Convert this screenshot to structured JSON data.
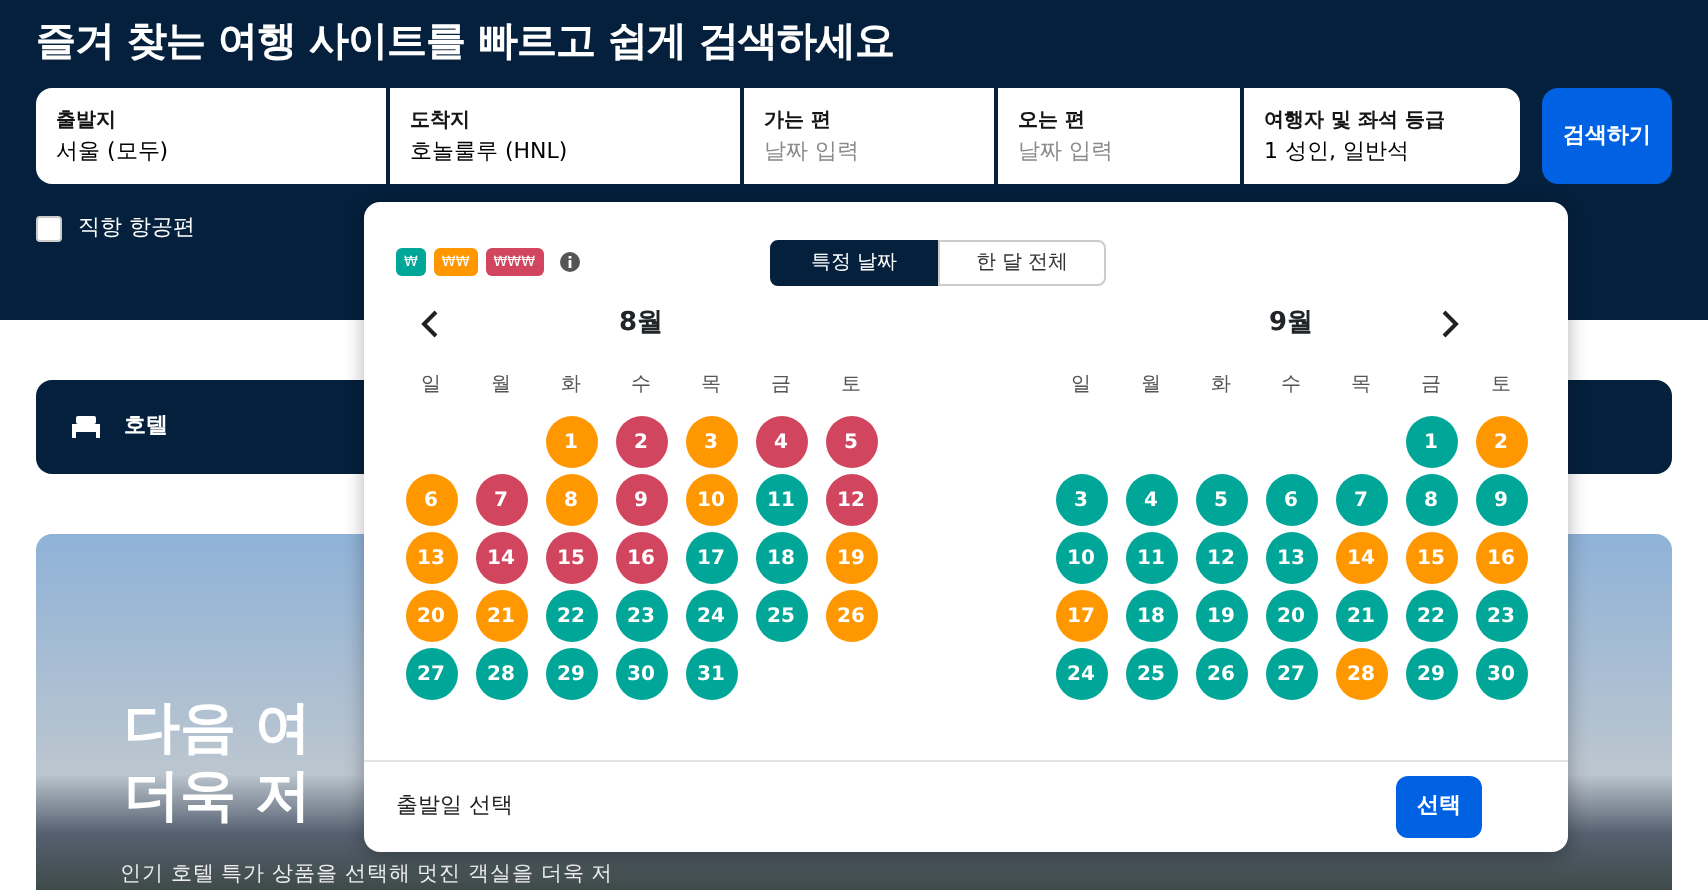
{
  "header": {
    "title": "즐겨 찾는 여행 사이트를 빠르고 쉽게 검색하세요"
  },
  "search_fields": [
    {
      "label": "출발지",
      "value": "서울 (모두)"
    },
    {
      "label": "도착지",
      "value": "호놀룰루 (HNL)"
    },
    {
      "label": "가는 편",
      "placeholder": "날짜 입력"
    },
    {
      "label": "오는 편",
      "placeholder": "날짜 입력"
    },
    {
      "label": "여행자 및 좌석 등급",
      "value": "1 성인, 일반석"
    }
  ],
  "search_button": "검색하기",
  "direct_flights": {
    "label": "직항 항공편",
    "checked": false
  },
  "hotel_tab": {
    "label": "호텔"
  },
  "hero": {
    "title_lines": [
      "다음 여",
      "더욱 저"
    ],
    "subtitle": "인기 호텔 특가 상품을 선택해 멋진 객실을 더욱 저"
  },
  "date_picker": {
    "legend": [
      {
        "label": "₩",
        "color": "#00a698"
      },
      {
        "label": "₩₩",
        "color": "#ff9800"
      },
      {
        "label": "₩₩₩",
        "color": "#d2455e"
      }
    ],
    "modes": [
      {
        "label": "특정 날짜",
        "selected": true
      },
      {
        "label": "한 달 전체",
        "selected": false
      }
    ],
    "months": [
      {
        "title": "8월",
        "weekdays": [
          "일",
          "월",
          "화",
          "수",
          "목",
          "금",
          "토"
        ],
        "weeks": [
          [
            {
              "day": "1",
              "color": "#ff9800"
            },
            {
              "day": "2",
              "color": "#d2455e"
            },
            {
              "day": "3",
              "color": "#ff9800"
            },
            {
              "day": "4",
              "color": "#d2455e"
            },
            {
              "day": "5",
              "color": "#d2455e"
            }
          ],
          [
            {
              "day": "6",
              "color": "#ff9800"
            },
            {
              "day": "7",
              "color": "#d2455e"
            },
            {
              "day": "8",
              "color": "#ff9800"
            },
            {
              "day": "9",
              "color": "#d2455e"
            },
            {
              "day": "10",
              "color": "#ff9800"
            },
            {
              "day": "11",
              "color": "#00a698"
            },
            {
              "day": "12",
              "color": "#d2455e"
            }
          ],
          [
            {
              "day": "13",
              "color": "#ff9800"
            },
            {
              "day": "14",
              "color": "#d2455e"
            },
            {
              "day": "15",
              "color": "#d2455e"
            },
            {
              "day": "16",
              "color": "#d2455e"
            },
            {
              "day": "17",
              "color": "#00a698"
            },
            {
              "day": "18",
              "color": "#00a698"
            },
            {
              "day": "19",
              "color": "#ff9800"
            }
          ],
          [
            {
              "day": "20",
              "color": "#ff9800"
            },
            {
              "day": "21",
              "color": "#ff9800"
            },
            {
              "day": "22",
              "color": "#00a698"
            },
            {
              "day": "23",
              "color": "#00a698"
            },
            {
              "day": "24",
              "color": "#00a698"
            },
            {
              "day": "25",
              "color": "#00a698"
            },
            {
              "day": "26",
              "color": "#ff9800"
            }
          ],
          [
            {
              "day": "27",
              "color": "#00a698"
            },
            {
              "day": "28",
              "color": "#00a698"
            },
            {
              "day": "29",
              "color": "#00a698"
            },
            {
              "day": "30",
              "color": "#00a698"
            },
            {
              "day": "31",
              "color": "#00a698"
            }
          ]
        ]
      },
      {
        "title": "9월",
        "weekdays": [
          "일",
          "월",
          "화",
          "수",
          "목",
          "금",
          "토"
        ],
        "weeks": [
          [
            {
              "day": "1",
              "color": "#00a698"
            },
            {
              "day": "2",
              "color": "#ff9800"
            }
          ],
          [
            {
              "day": "3",
              "color": "#00a698"
            },
            {
              "day": "4",
              "color": "#00a698"
            },
            {
              "day": "5",
              "color": "#00a698"
            },
            {
              "day": "6",
              "color": "#00a698"
            },
            {
              "day": "7",
              "color": "#00a698"
            },
            {
              "day": "8",
              "color": "#00a698"
            },
            {
              "day": "9",
              "color": "#00a698"
            }
          ],
          [
            {
              "day": "10",
              "color": "#00a698"
            },
            {
              "day": "11",
              "color": "#00a698"
            },
            {
              "day": "12",
              "color": "#00a698"
            },
            {
              "day": "13",
              "color": "#00a698"
            },
            {
              "day": "14",
              "color": "#ff9800"
            },
            {
              "day": "15",
              "color": "#ff9800"
            },
            {
              "day": "16",
              "color": "#ff9800"
            }
          ],
          [
            {
              "day": "17",
              "color": "#ff9800"
            },
            {
              "day": "18",
              "color": "#00a698"
            },
            {
              "day": "19",
              "color": "#00a698"
            },
            {
              "day": "20",
              "color": "#00a698"
            },
            {
              "day": "21",
              "color": "#00a698"
            },
            {
              "day": "22",
              "color": "#00a698"
            },
            {
              "day": "23",
              "color": "#00a698"
            }
          ],
          [
            {
              "day": "24",
              "color": "#00a698"
            },
            {
              "day": "25",
              "color": "#00a698"
            },
            {
              "day": "26",
              "color": "#00a698"
            },
            {
              "day": "27",
              "color": "#00a698"
            },
            {
              "day": "28",
              "color": "#ff9800"
            },
            {
              "day": "29",
              "color": "#00a698"
            },
            {
              "day": "30",
              "color": "#00a698"
            }
          ]
        ]
      }
    ],
    "footer_text": "출발일 선택",
    "confirm_button": "선택"
  }
}
